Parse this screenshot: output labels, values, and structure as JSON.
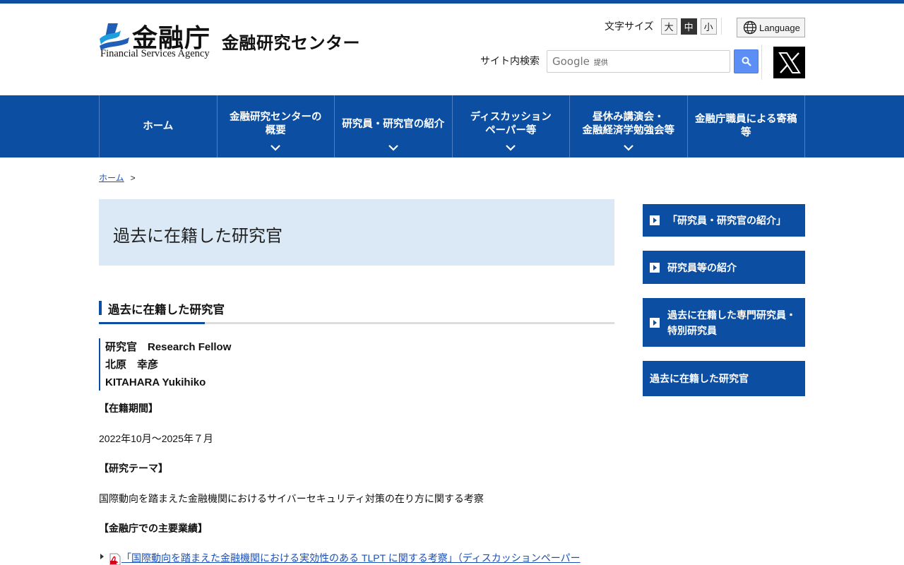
{
  "header": {
    "logo_jp": "金融庁",
    "logo_en": "Financial Services Agency",
    "site_name": "金融研究センター",
    "fontsize_label": "文字サイズ",
    "fontsize_options": [
      "大",
      "中",
      "小"
    ],
    "fontsize_selected": "中",
    "language_label": "Language",
    "search_label": "サイト内検索",
    "search_brand": "Google",
    "search_brand_suffix": "提供",
    "x_icon": "x-logo-icon"
  },
  "nav": {
    "items": [
      {
        "line1": "ホーム",
        "line2": "",
        "has_chevron": false
      },
      {
        "line1": "金融研究センターの",
        "line2": "概要",
        "has_chevron": true
      },
      {
        "line1": "研究員・研究官の紹介",
        "line2": "",
        "has_chevron": true
      },
      {
        "line1": "ディスカッション",
        "line2": "ペーパー等",
        "has_chevron": true
      },
      {
        "line1": "昼休み講演会・",
        "line2": "金融経済学勉強会等",
        "has_chevron": true
      },
      {
        "line1": "金融庁職員による寄稿",
        "line2": "等",
        "has_chevron": false
      }
    ]
  },
  "breadcrumb": {
    "home": "ホーム",
    "separator": ">"
  },
  "page": {
    "title": "過去に在籍した研究官",
    "section_heading": "過去に在籍した研究官",
    "profile": {
      "title_line": "研究官　Research Fellow",
      "name_jp": "北原　幸彦",
      "name_en": "KITAHARA Yukihiko"
    },
    "period_heading": "【在籍期間】",
    "period_value": "2022年10月～2025年７月",
    "theme_heading": "【研究テーマ】",
    "theme_value": "国際動向を踏まえた金融機関におけるサイバーセキュリティ対策の在り方に関する考察",
    "achievements_heading": "【金融庁での主要業績】",
    "achievement_link": "「国際動向を踏まえた金融機関における実効性のある TLPT に関する考察」（ディスカッションペーパー"
  },
  "sidebar": {
    "items": [
      {
        "label_1": "「研究員・研究官の紹介」",
        "label_2": ""
      },
      {
        "label_1": "研究員等の紹介",
        "label_2": ""
      },
      {
        "label_1": "過去に在籍した専門研究員・",
        "label_2": "特別研究員"
      },
      {
        "label_1": "過去に在籍した研究官",
        "label_2": ""
      }
    ]
  },
  "colors": {
    "brand_blue": "#0b4ea2",
    "title_bg": "#dbe9f6",
    "link": "#1a50b5"
  }
}
